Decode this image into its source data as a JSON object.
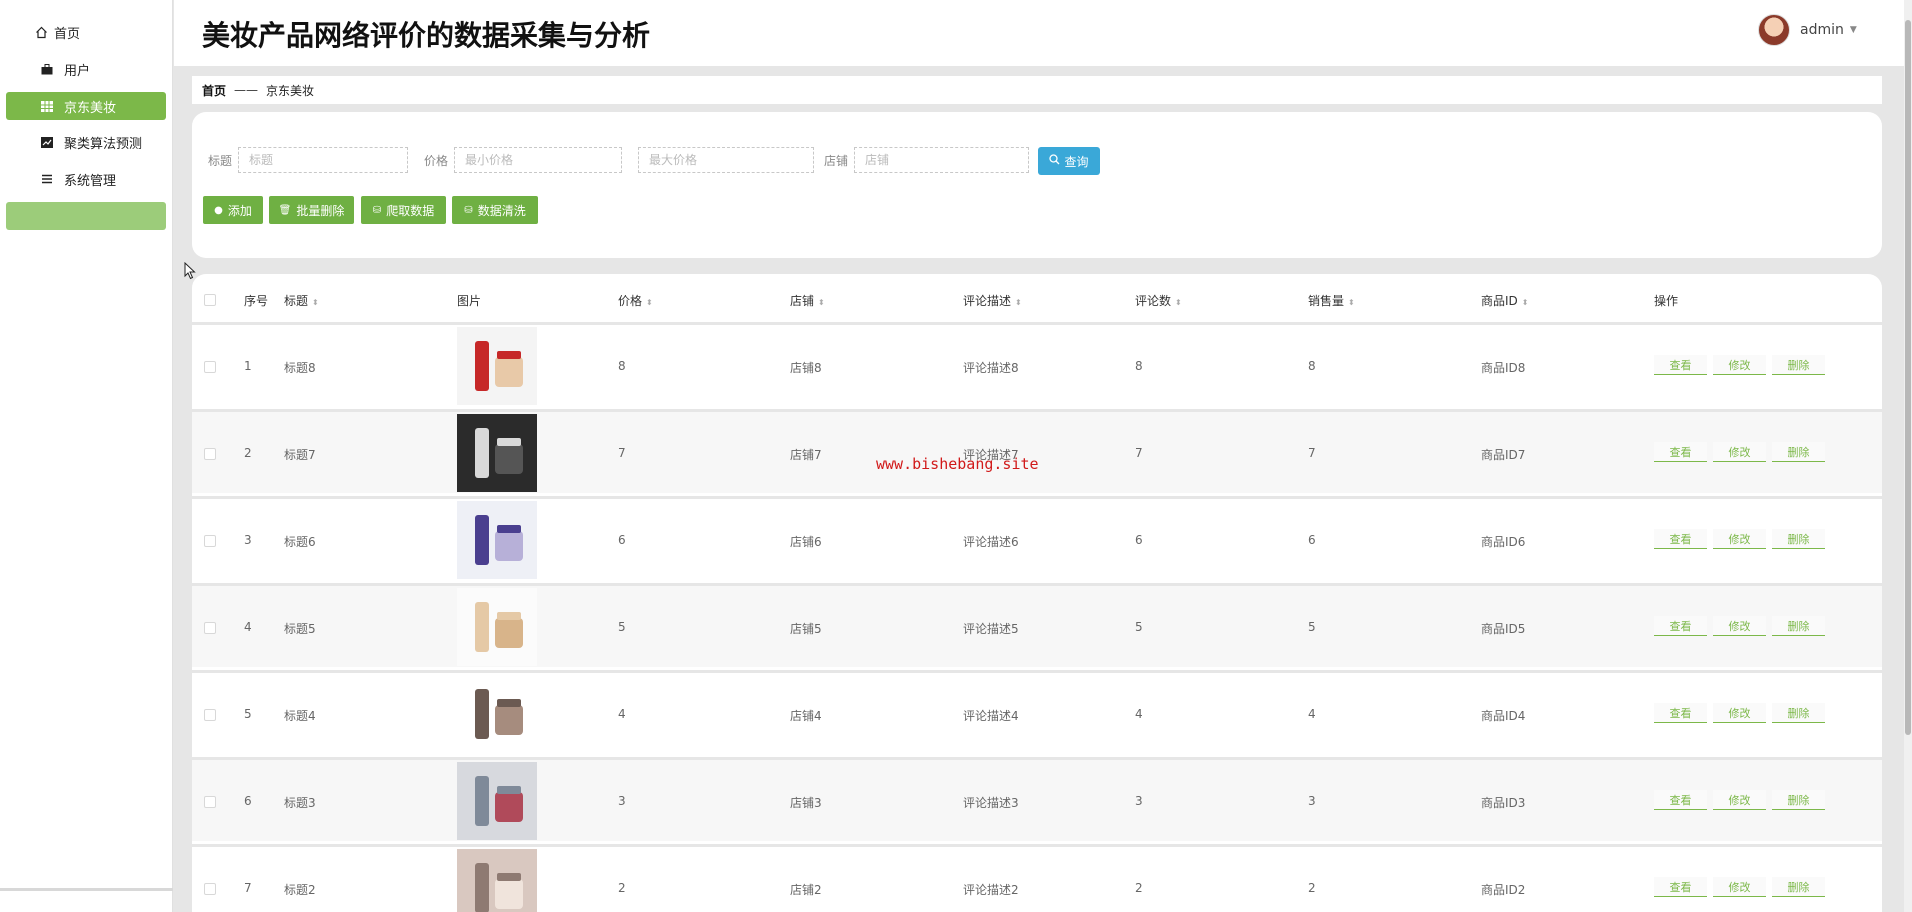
{
  "sidebar": {
    "items": [
      {
        "label": "首页",
        "icon": "home-icon"
      },
      {
        "label": "用户",
        "icon": "briefcase-icon"
      },
      {
        "label": "京东美妆",
        "icon": "grid-icon",
        "active": true
      },
      {
        "label": "聚类算法预测",
        "icon": "chart-icon"
      },
      {
        "label": "系统管理",
        "icon": "menu-icon"
      }
    ]
  },
  "header": {
    "title": "美妆产品网络评价的数据采集与分析",
    "username": "admin"
  },
  "breadcrumb": {
    "home": "首页",
    "separator": "——",
    "current": "京东美妆"
  },
  "search": {
    "title_label": "标题",
    "title_placeholder": "标题",
    "price_label": "价格",
    "min_price_placeholder": "最小价格",
    "max_price_placeholder": "最大价格",
    "shop_label": "店铺",
    "shop_placeholder": "店铺",
    "search_button": "查询"
  },
  "actions": {
    "add": "添加",
    "batch_delete": "批量删除",
    "crawl": "爬取数据",
    "clean": "数据清洗"
  },
  "table": {
    "columns": [
      "序号",
      "标题",
      "图片",
      "价格",
      "店铺",
      "评论描述",
      "评论数",
      "销售量",
      "商品ID",
      "操作"
    ],
    "rows": [
      {
        "index": "1",
        "title": "标题8",
        "price": "8",
        "shop": "店铺8",
        "desc": "评论描述8",
        "comments": "8",
        "sales": "8",
        "product_id": "商品ID8"
      },
      {
        "index": "2",
        "title": "标题7",
        "price": "7",
        "shop": "店铺7",
        "desc": "评论描述7",
        "comments": "7",
        "sales": "7",
        "product_id": "商品ID7"
      },
      {
        "index": "3",
        "title": "标题6",
        "price": "6",
        "shop": "店铺6",
        "desc": "评论描述6",
        "comments": "6",
        "sales": "6",
        "product_id": "商品ID6"
      },
      {
        "index": "4",
        "title": "标题5",
        "price": "5",
        "shop": "店铺5",
        "desc": "评论描述5",
        "comments": "5",
        "sales": "5",
        "product_id": "商品ID5"
      },
      {
        "index": "5",
        "title": "标题4",
        "price": "4",
        "shop": "店铺4",
        "desc": "评论描述4",
        "comments": "4",
        "sales": "4",
        "product_id": "商品ID4"
      },
      {
        "index": "6",
        "title": "标题3",
        "price": "3",
        "shop": "店铺3",
        "desc": "评论描述3",
        "comments": "3",
        "sales": "3",
        "product_id": "商品ID3"
      },
      {
        "index": "7",
        "title": "标题2",
        "price": "2",
        "shop": "店铺2",
        "desc": "评论描述2",
        "comments": "2",
        "sales": "2",
        "product_id": "商品ID2"
      }
    ],
    "ops": {
      "view": "查看",
      "edit": "修改",
      "delete": "删除"
    }
  },
  "watermark": "www.bishebang.site",
  "colors": {
    "accent": "#7cb849",
    "search": "#3aa8d8",
    "watermark": "#d11a1a"
  }
}
